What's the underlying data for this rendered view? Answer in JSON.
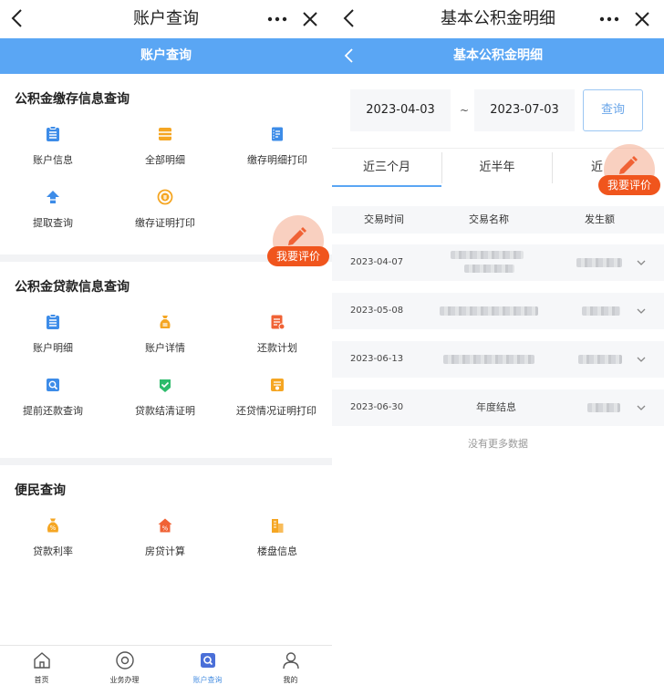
{
  "left": {
    "topbar": {
      "title": "账户查询"
    },
    "bluebar": {
      "title": "账户查询"
    },
    "sections": [
      {
        "title": "公积金缴存信息查询",
        "items": [
          {
            "label": "账户信息",
            "icon": "clipboard-icon"
          },
          {
            "label": "全部明细",
            "icon": "stack-icon"
          },
          {
            "label": "缴存明细打印",
            "icon": "notebook-icon"
          },
          {
            "label": "提取查询",
            "icon": "upload-icon"
          },
          {
            "label": "缴存证明打印",
            "icon": "coin-refresh-icon"
          }
        ]
      },
      {
        "title": "公积金贷款信息查询",
        "items": [
          {
            "label": "账户明细",
            "icon": "clipboard-icon"
          },
          {
            "label": "账户详情",
            "icon": "money-bag-icon"
          },
          {
            "label": "还款计划",
            "icon": "document-icon"
          },
          {
            "label": "提前还款查询",
            "icon": "search-doc-icon"
          },
          {
            "label": "贷款结清证明",
            "icon": "check-badge-icon"
          },
          {
            "label": "还贷情况证明打印",
            "icon": "certificate-icon"
          }
        ]
      },
      {
        "title": "便民查询",
        "items": [
          {
            "label": "贷款利率",
            "icon": "percent-bag-icon"
          },
          {
            "label": "房贷计算",
            "icon": "house-percent-icon"
          },
          {
            "label": "楼盘信息",
            "icon": "building-icon"
          }
        ]
      }
    ],
    "feedback": "我要评价",
    "tabbar": [
      {
        "label": "首页",
        "icon": "home-icon"
      },
      {
        "label": "业务办理",
        "icon": "compass-icon"
      },
      {
        "label": "账户查询",
        "icon": "account-query-icon"
      },
      {
        "label": "我的",
        "icon": "user-icon"
      }
    ],
    "active_tab": "账户查询"
  },
  "right": {
    "topbar": {
      "title": "基本公积金明细"
    },
    "bluebar": {
      "title": "基本公积金明细"
    },
    "date_from": "2023-04-03",
    "separator": "~",
    "date_to": "2023-07-03",
    "query_label": "查询",
    "periods": [
      "近三个月",
      "近半年",
      "近"
    ],
    "active_period": "近三个月",
    "feedback": "我要评价",
    "columns": [
      "交易时间",
      "交易名称",
      "发生额"
    ],
    "rows": [
      {
        "date": "2023-04-07",
        "name": "",
        "amount": "",
        "blurred": true
      },
      {
        "date": "2023-05-08",
        "name": "",
        "amount": "",
        "blurred": true
      },
      {
        "date": "2023-06-13",
        "name": "",
        "amount": "",
        "blurred": true
      },
      {
        "date": "2023-06-30",
        "name": "年度结息",
        "amount": "",
        "blurred": true
      }
    ],
    "no_more": "没有更多数据"
  },
  "colors": {
    "accent": "#5aa6f4",
    "feedback_orange": "#f0551d",
    "icon_blue": "#3d8ce8",
    "icon_orange": "#f5a623",
    "icon_green": "#2dbb6b",
    "icon_red": "#f06235"
  }
}
